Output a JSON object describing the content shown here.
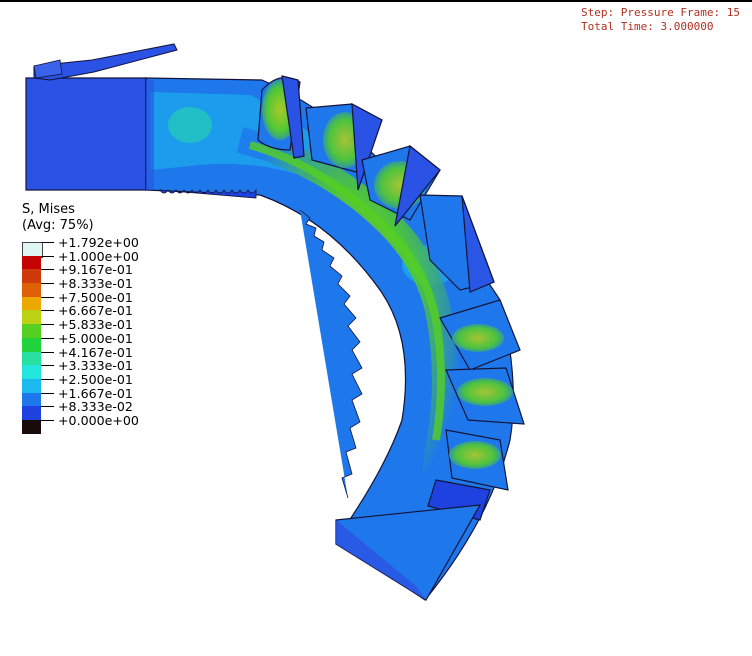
{
  "step_info": {
    "line1": "Step: Pressure Frame: 15",
    "line2": "Total Time: 3.000000"
  },
  "legend": {
    "variable": "S, Mises",
    "averaging": "(Avg: 75%)",
    "entries": [
      {
        "label": "+1.792e+00",
        "color": "#dff5f4"
      },
      {
        "label": "+1.000e+00",
        "color": "#c40404"
      },
      {
        "label": "+9.167e-01",
        "color": "#cf3a0a"
      },
      {
        "label": "+8.333e-01",
        "color": "#e06008"
      },
      {
        "label": "+7.500e-01",
        "color": "#eda800"
      },
      {
        "label": "+6.667e-01",
        "color": "#bcd114"
      },
      {
        "label": "+5.833e-01",
        "color": "#55d020"
      },
      {
        "label": "+5.000e-01",
        "color": "#21d43d"
      },
      {
        "label": "+4.167e-01",
        "color": "#28e0a0"
      },
      {
        "label": "+3.333e-01",
        "color": "#22e6dc"
      },
      {
        "label": "+2.500e-01",
        "color": "#1cb9ee"
      },
      {
        "label": "+1.667e-01",
        "color": "#1e78ec"
      },
      {
        "label": "+8.333e-02",
        "color": "#1e42e0"
      },
      {
        "label": "+0.000e+00",
        "color": "#1a0a0a"
      }
    ]
  },
  "colors": {
    "shell": "#2a56e6",
    "outline": "#1a1a3a",
    "low": "#1e78ec",
    "mid": "#28e0a0",
    "high": "#bcd114"
  }
}
